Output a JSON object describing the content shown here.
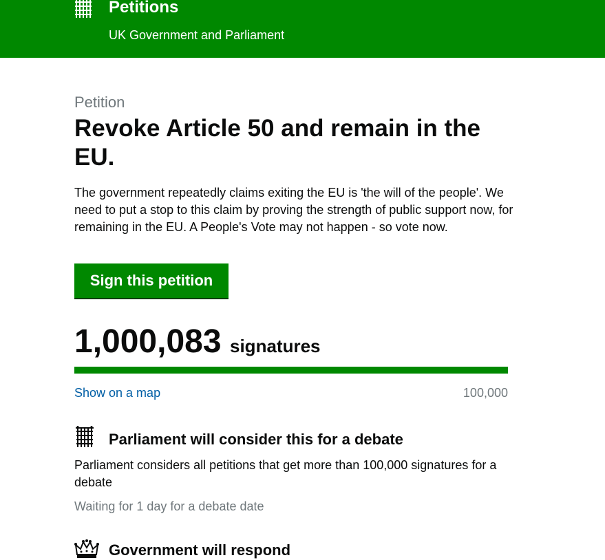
{
  "header": {
    "title": "Petitions",
    "subtitle": "UK Government and Parliament",
    "logo_icon": "portcullis-icon",
    "background_color": "#008800"
  },
  "petition": {
    "kicker": "Petition",
    "title": "Revoke Article 50 and remain in the EU.",
    "summary": "The government repeatedly claims exiting the EU is 'the will of the people'. We need to put a stop to this claim by proving the strength of public support now, for remaining in the EU. A People's Vote may not happen - so vote now.",
    "sign_button_label": "Sign this petition"
  },
  "signatures": {
    "count": "1,000,083",
    "label": "signatures",
    "progress_fraction": 1.0,
    "map_link": "Show on a map",
    "threshold": "100,000"
  },
  "debate": {
    "icon": "portcullis-icon",
    "title": "Parliament will consider this for a debate",
    "description": "Parliament considers all petitions that get more than 100,000 signatures for a debate",
    "status": "Waiting for 1 day for a debate date"
  },
  "response": {
    "icon": "crown-icon",
    "title": "Government will respond"
  },
  "colors": {
    "brand_green": "#008800",
    "link_blue": "#005ea5",
    "muted_grey": "#6f777b",
    "text": "#0b0c0c"
  }
}
